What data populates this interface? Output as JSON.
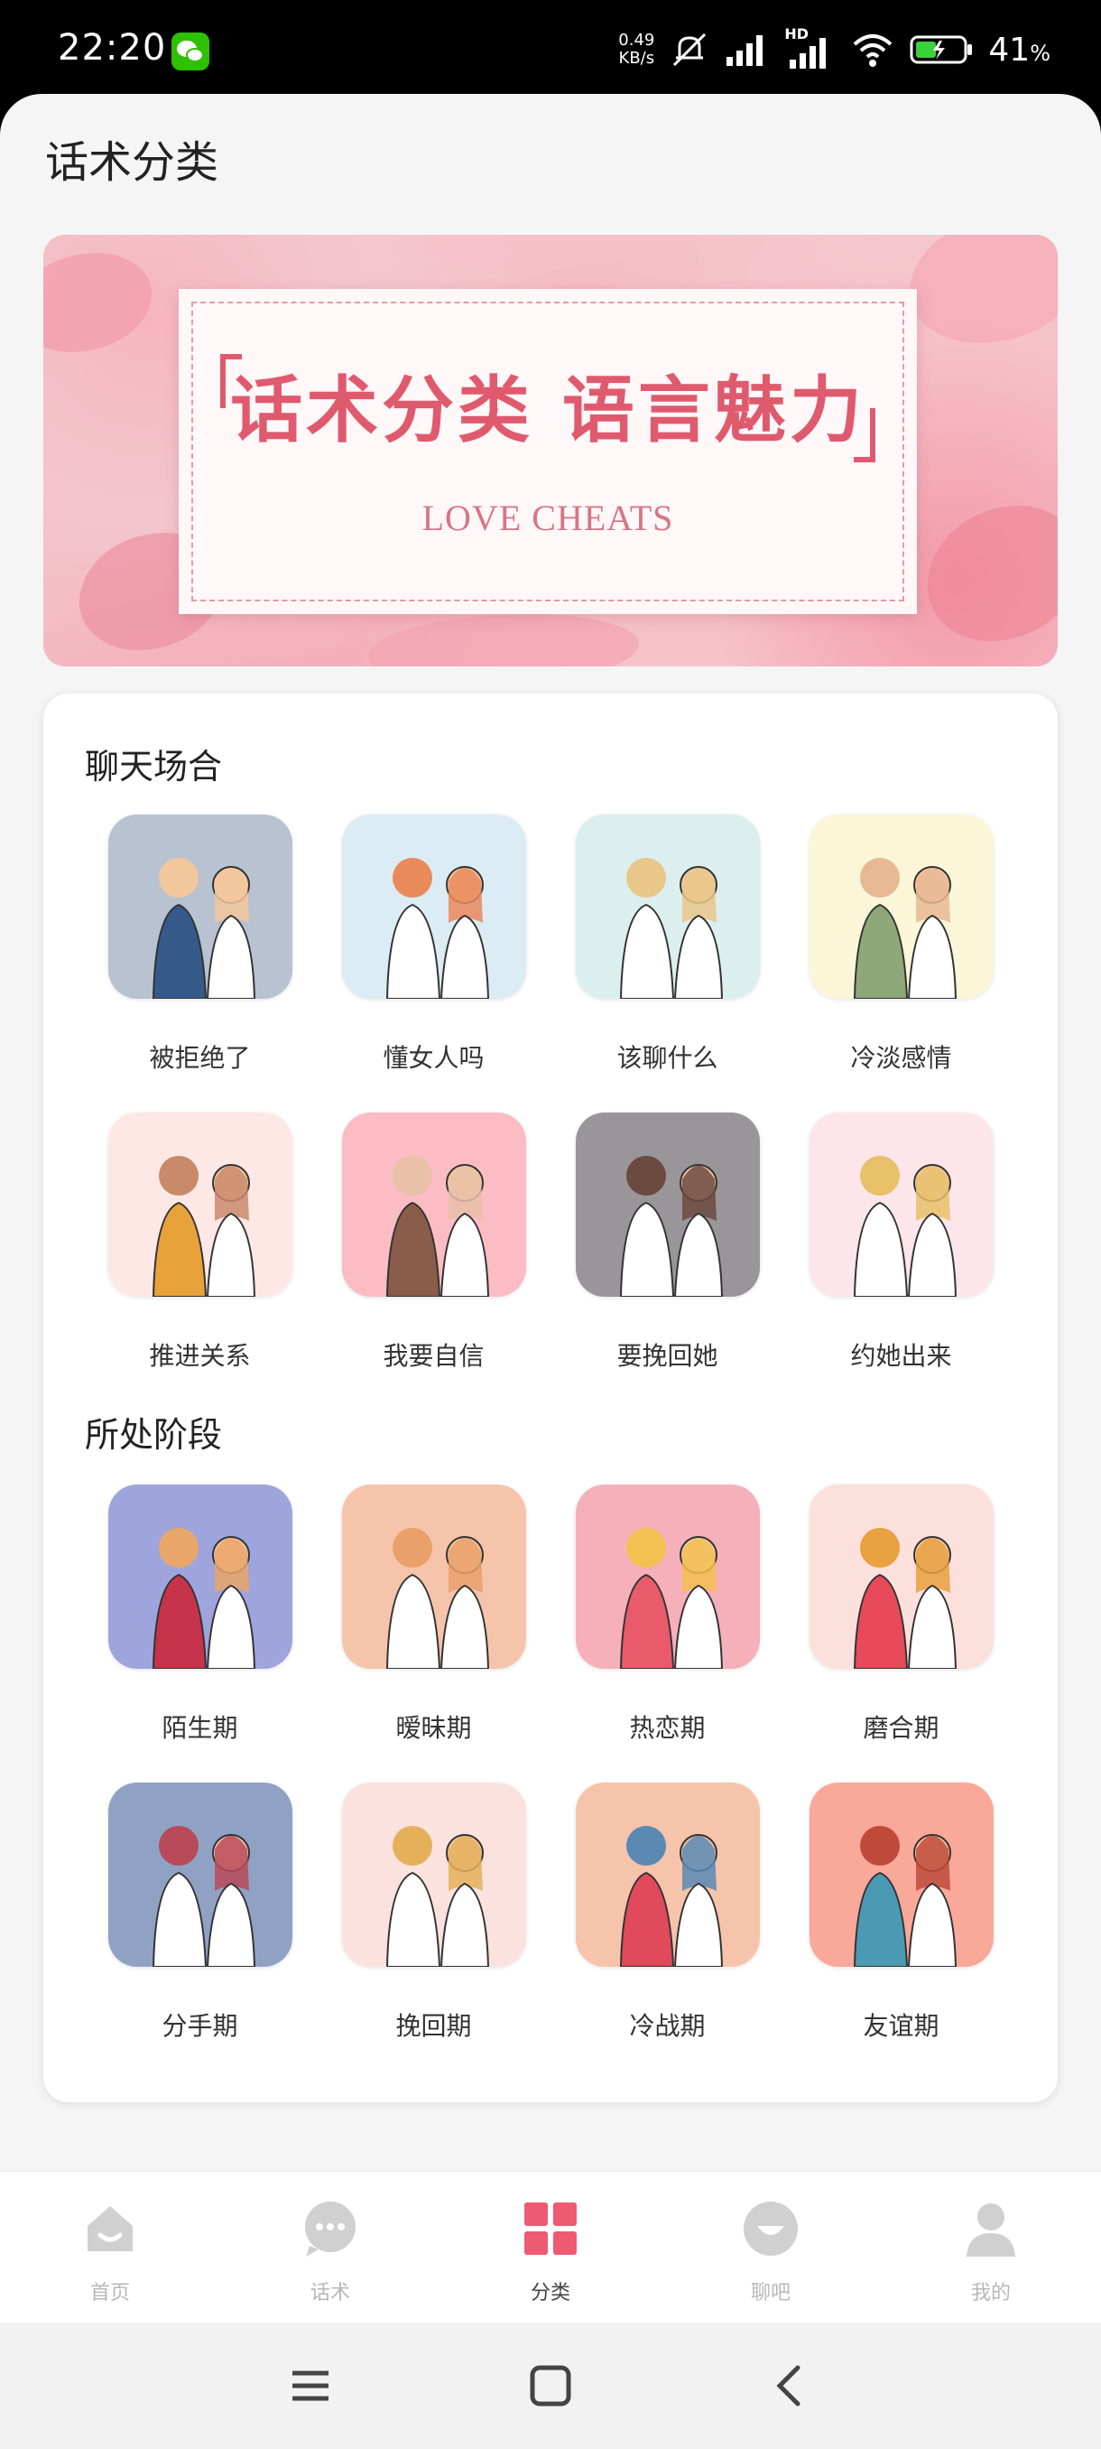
{
  "status_bar": {
    "time": "22:20",
    "net_speed_value": "0.49",
    "net_speed_unit": "KB/s",
    "network_badge": "HD",
    "battery": "41",
    "battery_unit": "%"
  },
  "page": {
    "title": "话术分类"
  },
  "banner": {
    "headline": "话术分类  语言魅力",
    "subtitle": "LOVE CHEATS"
  },
  "sections": [
    {
      "title": "聊天场合",
      "items": [
        {
          "label": "被拒绝了"
        },
        {
          "label": "懂女人吗"
        },
        {
          "label": "该聊什么"
        },
        {
          "label": "冷淡感情"
        },
        {
          "label": "推进关系"
        },
        {
          "label": "我要自信"
        },
        {
          "label": "要挽回她"
        },
        {
          "label": "约她出来"
        }
      ]
    },
    {
      "title": "所处阶段",
      "items": [
        {
          "label": "陌生期"
        },
        {
          "label": "暧昧期"
        },
        {
          "label": "热恋期"
        },
        {
          "label": "磨合期"
        },
        {
          "label": "分手期"
        },
        {
          "label": "挽回期"
        },
        {
          "label": "冷战期"
        },
        {
          "label": "友谊期"
        }
      ]
    }
  ],
  "bottom_nav": [
    {
      "label": "首页",
      "icon": "home-icon"
    },
    {
      "label": "话术",
      "icon": "chat-bubble-icon"
    },
    {
      "label": "分类",
      "icon": "category-grid-icon",
      "active": true
    },
    {
      "label": "聊吧",
      "icon": "smile-icon"
    },
    {
      "label": "我的",
      "icon": "profile-icon"
    }
  ],
  "colors": {
    "accent": "#ee5a72",
    "nav_inactive": "#cfcfcf",
    "banner_text": "#e05a6e"
  }
}
